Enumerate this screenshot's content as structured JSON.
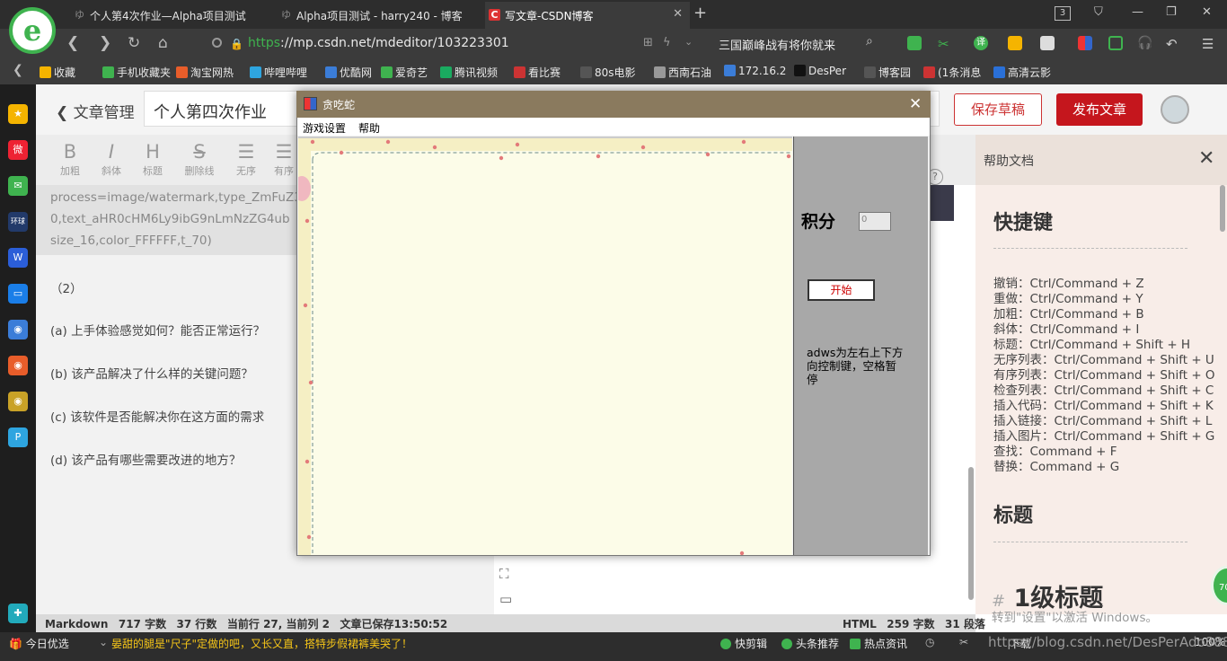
{
  "browser": {
    "tabs": [
      {
        "label": "个人第4次作业—Alpha项目测试",
        "active": false
      },
      {
        "label": "Alpha项目测试 - harry240 - 博客",
        "active": false
      },
      {
        "label": "写文章-CSDN博客",
        "active": true
      }
    ],
    "tab_count": "3",
    "url_scheme": "https",
    "url_rest": "://mp.csdn.net/mdeditor/103223301",
    "news_text": "三国巅峰战有将你就来",
    "bookmarks": [
      "收藏",
      "手机收藏夹",
      "淘宝网热",
      "哔哩哔哩",
      "优酷网",
      "爱奇艺",
      "腾讯视频",
      "看比赛",
      "80s电影",
      "西南石油",
      "172.16.2",
      "DesPer",
      "博客园",
      "(1条消息",
      "高清云影"
    ],
    "bookmark_colors": [
      "#f5b400",
      "#3fb34f",
      "#e85d2a",
      "#2ea5e0",
      "#3b7dd8",
      "#3fb34f",
      "#1aab60",
      "#c33",
      "#555",
      "#999",
      "#3b7dd8",
      "#111",
      "#555",
      "#c33",
      "#2a70d8"
    ]
  },
  "editor": {
    "back_label": "文章管理",
    "title": "个人第四次作业",
    "save_label": "保存草稿",
    "publish_label": "发布文章",
    "toolbar": [
      {
        "icon": "B",
        "label": "加粗"
      },
      {
        "icon": "I",
        "label": "斜体"
      },
      {
        "icon": "H",
        "label": "标题"
      },
      {
        "icon": "S",
        "label": "删除线"
      },
      {
        "icon": "☰",
        "label": "无序"
      },
      {
        "icon": "☰",
        "label": "有序"
      }
    ],
    "code_lines": [
      "process=image/watermark,type_ZmFuZ3",
      "0,text_aHR0cHM6Ly9ibG9nLmNzZG4ub",
      "size_16,color_FFFFFF,t_70)"
    ],
    "questions": [
      "（2）",
      "(a)   上手体验感觉如何？能否正常运行？",
      "(b)   该产品解决了什么样的关键问题？",
      "(c)   该软件是否能解决你在这方面的需求",
      "(d)   该产品有哪些需要改进的地方？"
    ],
    "help_q": "?"
  },
  "status": {
    "mode": "Markdown",
    "words": "717 字数",
    "lines": "37 行数",
    "cursor": "当前行 27, 当前列 2",
    "saved": "文章已保存13:50:52",
    "html_mode": "HTML",
    "html_words": "259 字数",
    "paragraphs": "31 段落"
  },
  "help": {
    "title": "帮助文档",
    "shortcut_heading": "快捷键",
    "divider": "------------------------------------------------",
    "shortcuts": [
      "撤销：Ctrl/Command + Z",
      "重做：Ctrl/Command + Y",
      "加粗：Ctrl/Command + B",
      "斜体：Ctrl/Command + I",
      "标题：Ctrl/Command + Shift + H",
      "无序列表：Ctrl/Command + Shift + U",
      "有序列表：Ctrl/Command + Shift + O",
      "检查列表：Ctrl/Command + Shift + C",
      "插入代码：Ctrl/Command + Shift + K",
      "插入链接：Ctrl/Command + Shift + L",
      "插入图片：Ctrl/Command + Shift + G",
      "查找：Command + F",
      "替换：Command + G"
    ],
    "title_heading": "标题",
    "h1_demo": "1级标题",
    "h1_prefix": "#",
    "activate": "转到\"设置\"以激活 Windows。",
    "ball": "70"
  },
  "taskbar": {
    "today": "今日优选",
    "news": "晏甜的腿是\"尺子\"定做的吧，又长又直，搭特步假裙裤美哭了！",
    "items": [
      "快剪辑",
      "头条推荐",
      "热点资讯"
    ],
    "download": "下载",
    "zoom": "100%",
    "watermark": "https://blog.csdn.net/DesPerAdo888"
  },
  "snake": {
    "window_title": "贪吃蛇",
    "menu": [
      "游戏设置",
      "帮助"
    ],
    "score_label": "积分",
    "score_value": "0",
    "start_label": "开始",
    "hint": "adws为左右上下方向控制键，空格暂停"
  }
}
